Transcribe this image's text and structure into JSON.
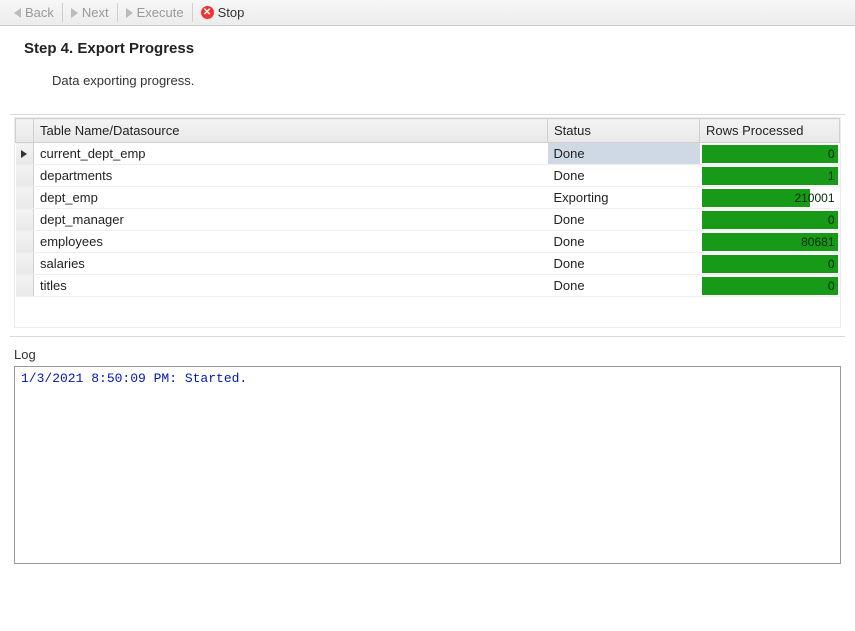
{
  "toolbar": {
    "back_label": "Back",
    "next_label": "Next",
    "execute_label": "Execute",
    "stop_label": "Stop"
  },
  "step": {
    "title": "Step 4. Export Progress",
    "description": "Data exporting progress."
  },
  "grid": {
    "headers": {
      "name": "Table Name/Datasource",
      "status": "Status",
      "rows": "Rows Processed"
    },
    "rows": [
      {
        "name": "current_dept_emp",
        "status": "Done",
        "rows": "0",
        "pct": 100,
        "selected": true
      },
      {
        "name": "departments",
        "status": "Done",
        "rows": "1",
        "pct": 100,
        "selected": false
      },
      {
        "name": "dept_emp",
        "status": "Exporting",
        "rows": "210001",
        "pct": 80,
        "selected": false
      },
      {
        "name": "dept_manager",
        "status": "Done",
        "rows": "0",
        "pct": 100,
        "selected": false
      },
      {
        "name": "employees",
        "status": "Done",
        "rows": "80681",
        "pct": 100,
        "selected": false
      },
      {
        "name": "salaries",
        "status": "Done",
        "rows": "0",
        "pct": 100,
        "selected": false
      },
      {
        "name": "titles",
        "status": "Done",
        "rows": "0",
        "pct": 100,
        "selected": false
      }
    ]
  },
  "log": {
    "label": "Log",
    "text": "1/3/2021 8:50:09 PM: Started."
  }
}
